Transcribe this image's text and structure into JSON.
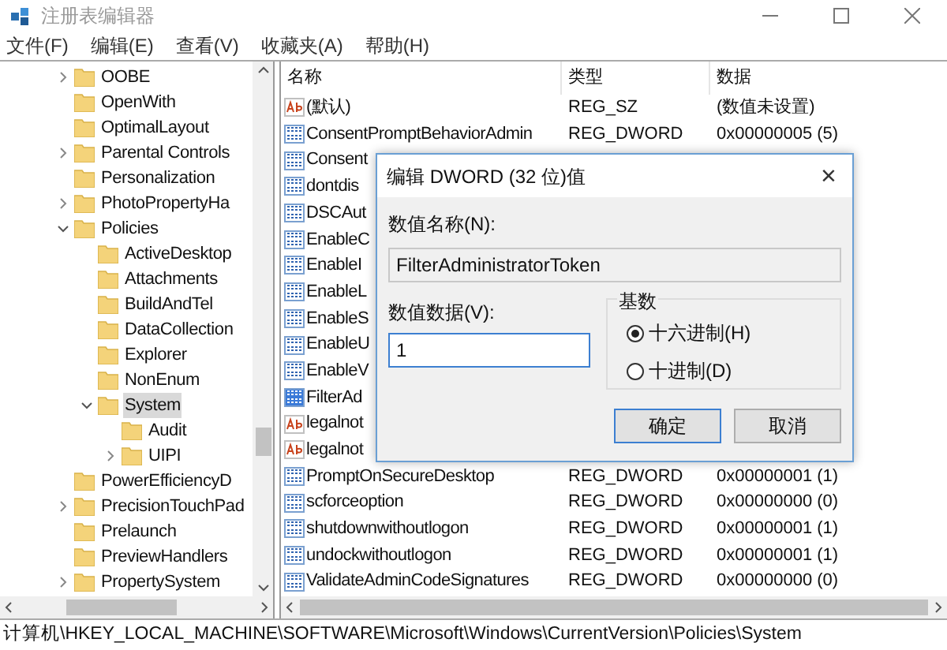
{
  "window": {
    "title": "注册表编辑器"
  },
  "menu": [
    "文件(F)",
    "编辑(E)",
    "查看(V)",
    "收藏夹(A)",
    "帮助(H)"
  ],
  "tree": [
    {
      "kind": "branch",
      "label": "OOBE",
      "expanded": false,
      "selected": false
    },
    {
      "kind": "leaf",
      "label": "OpenWith",
      "selected": false
    },
    {
      "kind": "leaf",
      "label": "OptimalLayout",
      "selected": false
    },
    {
      "kind": "branch",
      "label": "Parental Controls",
      "expanded": false,
      "selected": false
    },
    {
      "kind": "leaf",
      "label": "Personalization",
      "selected": false
    },
    {
      "kind": "branch",
      "label": "PhotoPropertyHa",
      "expanded": false,
      "selected": false
    },
    {
      "kind": "branch",
      "label": "Policies",
      "expanded": true,
      "selected": false,
      "children": [
        {
          "kind": "leaf",
          "label": "ActiveDesktop",
          "selected": false
        },
        {
          "kind": "leaf",
          "label": "Attachments",
          "selected": false
        },
        {
          "kind": "leaf",
          "label": "BuildAndTel",
          "selected": false
        },
        {
          "kind": "leaf",
          "label": "DataCollection",
          "selected": false
        },
        {
          "kind": "leaf",
          "label": "Explorer",
          "selected": false
        },
        {
          "kind": "leaf",
          "label": "NonEnum",
          "selected": false
        },
        {
          "kind": "branch",
          "label": "System",
          "expanded": true,
          "selected": true,
          "children": [
            {
              "kind": "leaf",
              "label": "Audit",
              "selected": false
            },
            {
              "kind": "branch",
              "label": "UIPI",
              "expanded": false,
              "selected": false
            }
          ]
        }
      ]
    },
    {
      "kind": "leaf",
      "label": "PowerEfficiencyD",
      "selected": false
    },
    {
      "kind": "branch",
      "label": "PrecisionTouchPad",
      "expanded": false,
      "selected": false
    },
    {
      "kind": "leaf",
      "label": "Prelaunch",
      "selected": false
    },
    {
      "kind": "leaf",
      "label": "PreviewHandlers",
      "selected": false
    },
    {
      "kind": "branch",
      "label": "PropertySystem",
      "expanded": false,
      "selected": false
    }
  ],
  "table": {
    "columns": [
      "名称",
      "类型",
      "数据"
    ],
    "rows": [
      {
        "kind": "string",
        "name": "(默认)",
        "type": "REG_SZ",
        "data": "(数值未设置)",
        "selected": false
      },
      {
        "kind": "dword",
        "name": "ConsentPromptBehaviorAdmin",
        "type": "REG_DWORD",
        "data": "0x00000005 (5)",
        "selected": false
      },
      {
        "kind": "dword",
        "name": "Consent",
        "selected": false
      },
      {
        "kind": "dword",
        "name": "dontdis",
        "selected": false
      },
      {
        "kind": "dword",
        "name": "DSCAut",
        "selected": false
      },
      {
        "kind": "dword",
        "name": "EnableC",
        "selected": false
      },
      {
        "kind": "dword",
        "name": "EnableI",
        "selected": false
      },
      {
        "kind": "dword",
        "name": "EnableL",
        "selected": false
      },
      {
        "kind": "dword",
        "name": "EnableS",
        "selected": false
      },
      {
        "kind": "dword",
        "name": "EnableU",
        "selected": false
      },
      {
        "kind": "dword",
        "name": "EnableV",
        "selected": false
      },
      {
        "kind": "dword",
        "name": "FilterAd",
        "selected": true
      },
      {
        "kind": "string",
        "name": "legalnot",
        "selected": false
      },
      {
        "kind": "string",
        "name": "legalnot",
        "selected": false
      },
      {
        "kind": "dword",
        "name": "PromptOnSecureDesktop",
        "type": "REG_DWORD",
        "data": "0x00000001 (1)",
        "selected": false
      },
      {
        "kind": "dword",
        "name": "scforceoption",
        "type": "REG_DWORD",
        "data": "0x00000000 (0)",
        "selected": false
      },
      {
        "kind": "dword",
        "name": "shutdownwithoutlogon",
        "type": "REG_DWORD",
        "data": "0x00000001 (1)",
        "selected": false
      },
      {
        "kind": "dword",
        "name": "undockwithoutlogon",
        "type": "REG_DWORD",
        "data": "0x00000001 (1)",
        "selected": false
      },
      {
        "kind": "dword",
        "name": "ValidateAdminCodeSignatures",
        "type": "REG_DWORD",
        "data": "0x00000000 (0)",
        "selected": false
      }
    ]
  },
  "dialog": {
    "title": "编辑 DWORD (32 位)值",
    "close": "×",
    "name_label": "数值名称(N):",
    "name_value": "FilterAdministratorToken",
    "data_label": "数值数据(V):",
    "data_value": "1",
    "base_label": "基数",
    "radios": [
      {
        "label": "十六进制(H)",
        "selected": true
      },
      {
        "label": "十进制(D)",
        "selected": false
      }
    ],
    "buttons": [
      "确定",
      "取消"
    ]
  },
  "status_bar": "计算机\\HKEY_LOCAL_MACHINE\\SOFTWARE\\Microsoft\\Windows\\CurrentVersion\\Policies\\System"
}
